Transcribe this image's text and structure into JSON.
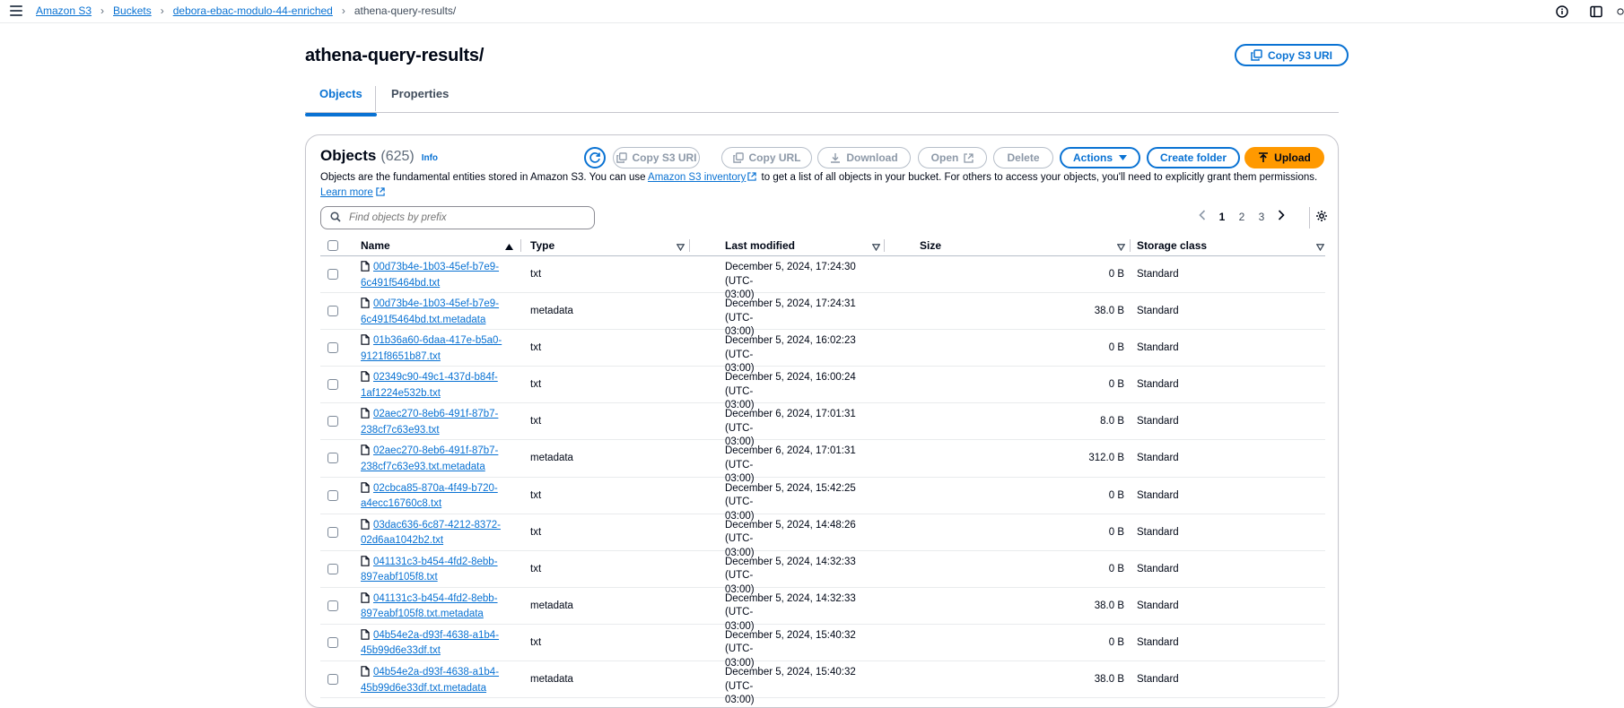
{
  "breadcrumb": {
    "items": [
      "Amazon S3",
      "Buckets",
      "debora-ebac-modulo-44-enriched"
    ],
    "current": "athena-query-results/"
  },
  "page": {
    "title": "athena-query-results/",
    "copy_uri_label": "Copy S3 URI"
  },
  "tabs": [
    {
      "label": "Objects",
      "active": true
    },
    {
      "label": "Properties",
      "active": false
    }
  ],
  "objects_panel": {
    "title": "Objects",
    "count": "(625)",
    "info": "Info",
    "desc_pre": "Objects are the fundamental entities stored in Amazon S3. You can use ",
    "desc_link": "Amazon S3 inventory",
    "desc_post": " to get a list of all objects in your bucket. For others to access your objects, you'll need to explicitly grant them permissions.",
    "learn_more": "Learn more",
    "buttons": {
      "copy_s3_uri": "Copy S3 URI",
      "copy_url": "Copy URL",
      "download": "Download",
      "open": "Open",
      "delete": "Delete",
      "actions": "Actions",
      "create_folder": "Create folder",
      "upload": "Upload"
    },
    "search_placeholder": "Find objects by prefix",
    "pages": [
      "1",
      "2",
      "3"
    ],
    "current_page": "1"
  },
  "table": {
    "columns": [
      "Name",
      "Type",
      "Last modified",
      "Size",
      "Storage class"
    ],
    "rows": [
      {
        "name1": "00d73b4e-1b03-45ef-b7e9-",
        "name2": "6c491f5464bd.txt",
        "type": "txt",
        "date1": "December 5, 2024, 17:24:30 (UTC-",
        "date2": "03:00)",
        "size": "0 B",
        "class": "Standard"
      },
      {
        "name1": "00d73b4e-1b03-45ef-b7e9-",
        "name2": "6c491f5464bd.txt.metadata",
        "type": "metadata",
        "date1": "December 5, 2024, 17:24:31 (UTC-",
        "date2": "03:00)",
        "size": "38.0 B",
        "class": "Standard"
      },
      {
        "name1": "01b36a60-6daa-417e-b5a0-",
        "name2": "9121f8651b87.txt",
        "type": "txt",
        "date1": "December 5, 2024, 16:02:23 (UTC-",
        "date2": "03:00)",
        "size": "0 B",
        "class": "Standard"
      },
      {
        "name1": "02349c90-49c1-437d-b84f-",
        "name2": "1af1224e532b.txt",
        "type": "txt",
        "date1": "December 5, 2024, 16:00:24 (UTC-",
        "date2": "03:00)",
        "size": "0 B",
        "class": "Standard"
      },
      {
        "name1": "02aec270-8eb6-491f-87b7-",
        "name2": "238cf7c63e93.txt",
        "type": "txt",
        "date1": "December 6, 2024, 17:01:31 (UTC-",
        "date2": "03:00)",
        "size": "8.0 B",
        "class": "Standard"
      },
      {
        "name1": "02aec270-8eb6-491f-87b7-",
        "name2": "238cf7c63e93.txt.metadata",
        "type": "metadata",
        "date1": "December 6, 2024, 17:01:31 (UTC-",
        "date2": "03:00)",
        "size": "312.0 B",
        "class": "Standard"
      },
      {
        "name1": "02cbca85-870a-4f49-b720-",
        "name2": "a4ecc16760c8.txt",
        "type": "txt",
        "date1": "December 5, 2024, 15:42:25 (UTC-",
        "date2": "03:00)",
        "size": "0 B",
        "class": "Standard"
      },
      {
        "name1": "03dac636-6c87-4212-8372-",
        "name2": "02d6aa1042b2.txt",
        "type": "txt",
        "date1": "December 5, 2024, 14:48:26 (UTC-",
        "date2": "03:00)",
        "size": "0 B",
        "class": "Standard"
      },
      {
        "name1": "041131c3-b454-4fd2-8ebb-",
        "name2": "897eabf105f8.txt",
        "type": "txt",
        "date1": "December 5, 2024, 14:32:33 (UTC-",
        "date2": "03:00)",
        "size": "0 B",
        "class": "Standard"
      },
      {
        "name1": "041131c3-b454-4fd2-8ebb-",
        "name2": "897eabf105f8.txt.metadata",
        "type": "metadata",
        "date1": "December 5, 2024, 14:32:33 (UTC-",
        "date2": "03:00)",
        "size": "38.0 B",
        "class": "Standard"
      },
      {
        "name1": "04b54e2a-d93f-4638-a1b4-",
        "name2": "45b99d6e33df.txt",
        "type": "txt",
        "date1": "December 5, 2024, 15:40:32 (UTC-",
        "date2": "03:00)",
        "size": "0 B",
        "class": "Standard"
      },
      {
        "name1": "04b54e2a-d93f-4638-a1b4-",
        "name2": "45b99d6e33df.txt.metadata",
        "type": "metadata",
        "date1": "December 5, 2024, 15:40:32 (UTC-",
        "date2": "03:00)",
        "size": "38.0 B",
        "class": "Standard"
      }
    ]
  },
  "colors": {
    "link": "#0972d3",
    "primary_button": "#ff9900",
    "border": "#c6c6cd",
    "text": "#000716"
  }
}
